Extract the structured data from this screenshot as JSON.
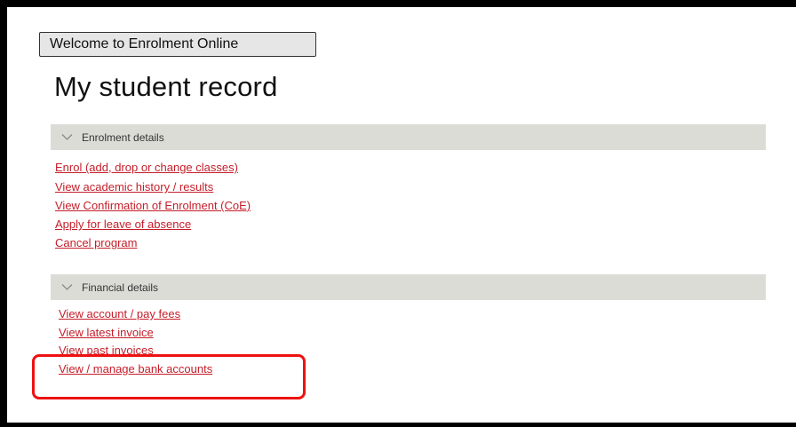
{
  "header": {
    "welcome_button": "Welcome to Enrolment Online",
    "page_title": "My student record"
  },
  "sections": {
    "enrolment": {
      "title": "Enrolment details",
      "links": [
        "Enrol (add, drop or change classes)",
        "View academic history / results",
        "View Confirmation of Enrolment (CoE)",
        "Apply for leave of absence",
        "Cancel program"
      ]
    },
    "financial": {
      "title": "Financial details",
      "links": [
        "View account / pay fees",
        "View latest invoice",
        "View past invoices",
        "View / manage bank accounts"
      ]
    }
  },
  "highlighted_item": "View / manage bank accounts",
  "colors": {
    "link": "#c51e2a",
    "section_header_bg": "#dcdcd7",
    "highlight_border": "#ee1111"
  },
  "icons": {
    "section_toggle": "chevron-down-icon"
  }
}
